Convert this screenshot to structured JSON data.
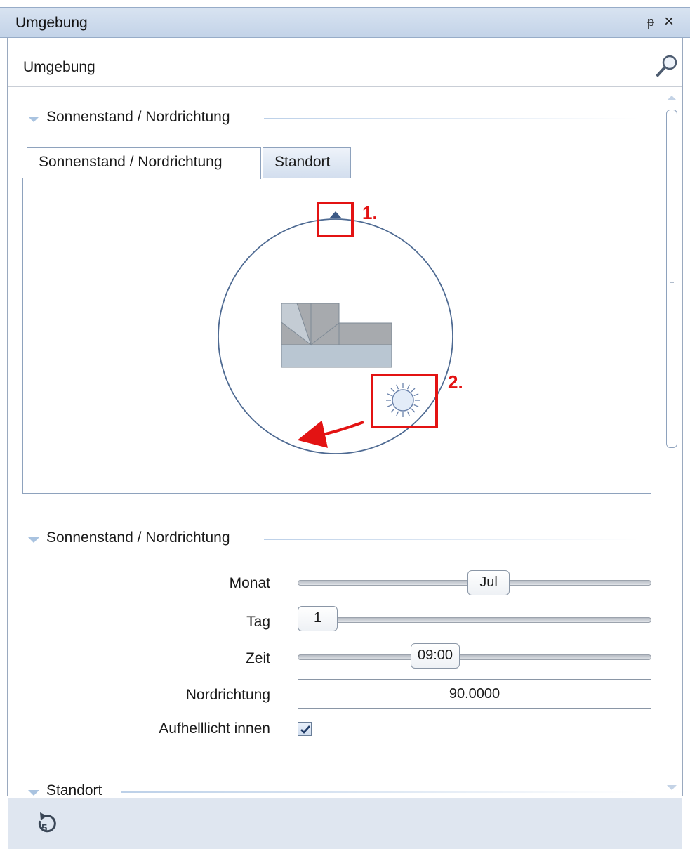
{
  "window": {
    "title": "Umgebung",
    "pin_glyph": "ᵱ",
    "close_glyph": "×"
  },
  "search": {
    "label": "Umgebung",
    "icon": "search-icon"
  },
  "section_sun": {
    "title": "Sonnenstand / Nordrichtung"
  },
  "tabs": [
    {
      "label": "Sonnenstand / Nordrichtung",
      "active": true
    },
    {
      "label": "Standort",
      "active": false
    }
  ],
  "annotations": {
    "marker1": "1.",
    "marker2": "2.",
    "color": "#e31313"
  },
  "section_settings": {
    "title": "Sonnenstand / Nordrichtung"
  },
  "form": {
    "month": {
      "label": "Monat",
      "value": "Jul"
    },
    "day": {
      "label": "Tag",
      "value": "1"
    },
    "time": {
      "label": "Zeit",
      "value": "09:00"
    },
    "north": {
      "label": "Nordrichtung",
      "value": "90.0000"
    },
    "fill_light": {
      "label": "Aufhelllicht innen",
      "checked": true
    }
  },
  "section_location": {
    "title": "Standort"
  },
  "footer": {
    "icon": "reset-icon"
  }
}
